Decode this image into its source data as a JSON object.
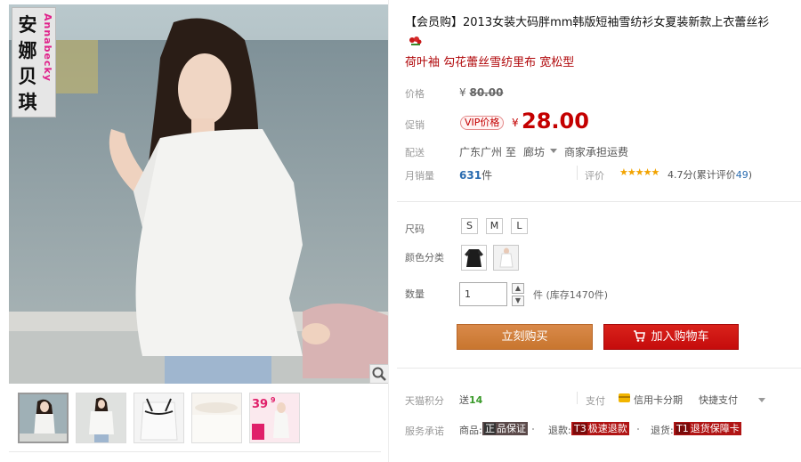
{
  "gallery": {
    "brand_cn_lines": [
      "安",
      "娜",
      "贝",
      "琪"
    ],
    "brand_en": "Annabecky",
    "zoom_icon": "magnifier-icon",
    "thumb_count": 5,
    "thumb_promo": {
      "price": "39",
      "suffix": "9"
    }
  },
  "product": {
    "title": "【会员购】2013女装大码胖mm韩版短袖雪纺衫女夏装新款上衣蕾丝衫",
    "title_icon": "flower-icon",
    "subtitle": "荷叶袖 勾花蕾丝雪纺里布 宽松型"
  },
  "price": {
    "label_original": "价格",
    "currency": "¥",
    "original": "80.00",
    "label_promo": "促销",
    "vip_badge": "VIP价格",
    "current": "28.00"
  },
  "shipping": {
    "label": "配送",
    "from": "广东广州",
    "to_word": "至",
    "destination": "廊坊",
    "fee": "商家承担运费"
  },
  "sales": {
    "label": "月销量",
    "count": "631",
    "unit": "件",
    "review_label": "评价",
    "stars": "★★★★★",
    "score": "4.7分",
    "review_prefix": "(累计评价",
    "review_count": "49",
    "review_suffix": ")"
  },
  "options": {
    "size_label": "尺码",
    "sizes": [
      "S",
      "M",
      "L"
    ],
    "color_label": "颜色分类",
    "colors": [
      {
        "name": "black",
        "color": "#1c1c1c"
      },
      {
        "name": "white",
        "color": "#f4f4f4"
      }
    ],
    "qty_label": "数量",
    "qty_value": "1",
    "stock_text": "件 (库存1470件)"
  },
  "actions": {
    "buy_now": "立刻购买",
    "add_to_cart": "加入购物车"
  },
  "extras": {
    "points_label": "天猫积分",
    "points_prefix": "送",
    "points_value": "14",
    "pay_label": "支付",
    "pay_card": "信用卡分期",
    "pay_quick": "快捷支付",
    "service_label": "服务承诺",
    "service_goods": "商品:",
    "badge_1_code": "正",
    "badge_1_text": "品保证",
    "service_refund": "退款:",
    "badge_2_code": "T3",
    "badge_2_text": "极速退款",
    "service_return": "退货:",
    "badge_3_code": "T1",
    "badge_3_text": "退货保障卡"
  },
  "colors": {
    "price_red": "#c40000",
    "buy_orange": "#cf7d38",
    "cart_red": "#cc1111",
    "subtitle_red": "#b0070a",
    "link_blue": "#2a6cb0"
  }
}
